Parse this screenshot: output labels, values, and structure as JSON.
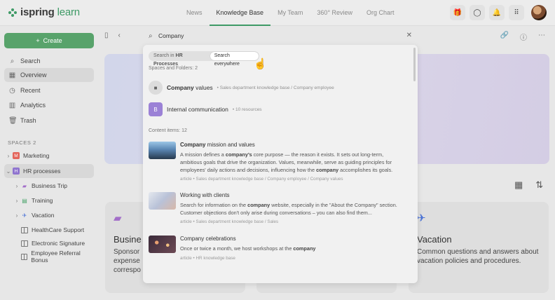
{
  "app": {
    "logo_brand": "ispring",
    "logo_product": "learn"
  },
  "topnav": {
    "items": [
      "News",
      "Knowledge Base",
      "My Team",
      "360° Review",
      "Org Chart"
    ],
    "active": "Knowledge Base"
  },
  "top_icons": [
    "gift-icon",
    "chat-icon",
    "bell-icon",
    "apps-grid-icon",
    "user-avatar"
  ],
  "sidebar": {
    "create_label": "Create",
    "items": [
      {
        "label": "Search",
        "icon": "search-icon"
      },
      {
        "label": "Overview",
        "icon": "grid-icon",
        "selected": true
      },
      {
        "label": "Recent",
        "icon": "clock-icon"
      },
      {
        "label": "Analytics",
        "icon": "chart-icon"
      },
      {
        "label": "Trash",
        "icon": "trash-icon"
      }
    ],
    "spaces_label": "SPACES 2",
    "spaces": [
      {
        "label": "Marketing",
        "letter": "M",
        "color": "#e3655b"
      },
      {
        "label": "HR processes",
        "letter": "H",
        "color": "#8f74cf",
        "selected": true
      }
    ],
    "children": [
      {
        "label": "Business Trip",
        "icon": "briefcase-icon"
      },
      {
        "label": "Training",
        "icon": "training-icon"
      },
      {
        "label": "Vacation",
        "icon": "plane-icon"
      },
      {
        "label": "HealthCare Support",
        "icon": "book-icon"
      },
      {
        "label": "Electronic Signature",
        "icon": "book-icon"
      },
      {
        "label": "Employee Referral Bonus",
        "icon": "book-icon"
      }
    ]
  },
  "search": {
    "value": "Company",
    "scope_options": [
      {
        "prefix": "Search in ",
        "bold": "HR Processes"
      },
      {
        "prefix": "Search everywhere",
        "bold": ""
      }
    ],
    "active_scope": 1,
    "spaces_label": "Spaces and Folders: 2",
    "spaces_results": [
      {
        "title_bold": "Company",
        "title_rest": " values",
        "meta": "Sales department knowledge base / Company employee"
      },
      {
        "title_bold": "",
        "title_rest": "Internal communication",
        "meta": "10 resources",
        "letter": "B"
      }
    ],
    "content_label": "Content items: 12",
    "content_results": [
      {
        "title_bold": "Company",
        "title_rest": " mission and values",
        "desc_parts": [
          "A mission defines a ",
          "company's",
          " core purpose — the reason it exists. It sets out long-term, ambitious goals that drive the organization. Values, meanwhile, serve as guiding principles for employees' daily actions and decisions, influencing how the ",
          "company",
          " accomplishes its goals."
        ],
        "meta": "article  •  Sales department knowledge base / Company employee / Company values"
      },
      {
        "title_bold": "",
        "title_rest": "Working with clients",
        "desc_parts": [
          "Search for information on the ",
          "company",
          " website, especially in the \"About the Company\" section. Customer objections don't only arise during conversations – you can also find them..."
        ],
        "meta": "article  •  Sales department knowledge base / Sales"
      },
      {
        "title_bold": "",
        "title_rest": "Company celebrations",
        "desc_parts": [
          "Once or twice a month, we host workshops at the ",
          "company",
          ""
        ],
        "meta": "article  •  HR knowledge base"
      }
    ]
  },
  "cards": [
    {
      "title": "Busine",
      "desc": "Sponsor\nexpense\ncorrespo",
      "icon": "briefcase-icon"
    },
    {
      "title": "Vacation",
      "desc": "Common questions and answers about vacation policies and procedures.",
      "icon": "plane-icon"
    }
  ]
}
